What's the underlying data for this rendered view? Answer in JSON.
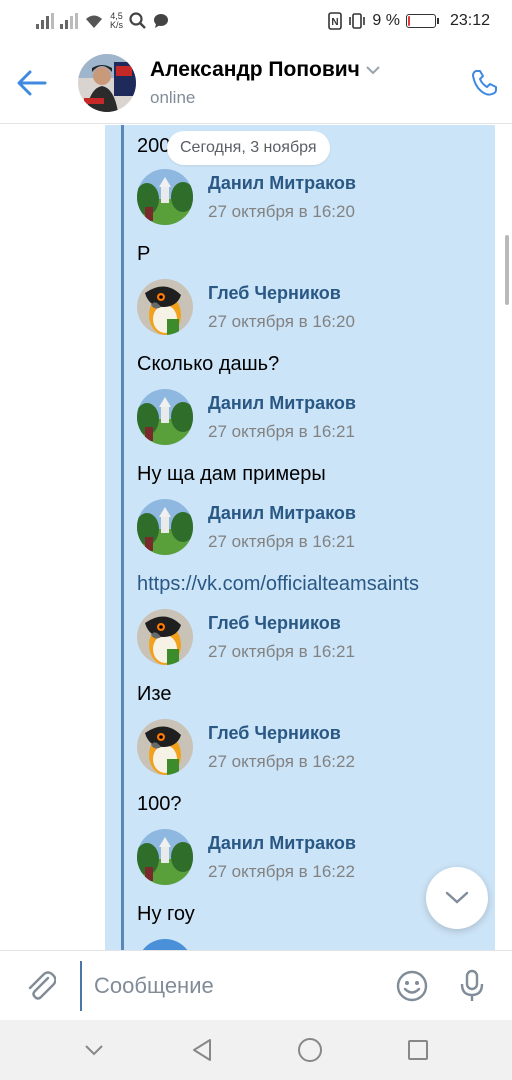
{
  "status_bar": {
    "speed_value": "4,5",
    "speed_unit": "K/s",
    "battery_percent": "9 %",
    "battery_level": 0.09,
    "time": "23:12"
  },
  "header": {
    "title": "Александр Попович",
    "status": "online"
  },
  "date_badge": "Сегодня, 3 ноября",
  "messages": [
    {
      "type": "text",
      "text": "200"
    },
    {
      "type": "sender",
      "name": "Данил Митраков",
      "time": "27 октября в 16:20",
      "avatar": "park-photo"
    },
    {
      "type": "text",
      "text": "Р"
    },
    {
      "type": "sender",
      "name": "Глеб Черников",
      "time": "27 октября в 16:20",
      "avatar": "parrot-photo"
    },
    {
      "type": "text",
      "text": "Сколько дашь?"
    },
    {
      "type": "sender",
      "name": "Данил Митраков",
      "time": "27 октября в 16:21",
      "avatar": "park-photo"
    },
    {
      "type": "text",
      "text": "Ну ща дам примеры"
    },
    {
      "type": "sender",
      "name": "Данил Митраков",
      "time": "27 октября в 16:21",
      "avatar": "park-photo"
    },
    {
      "type": "link",
      "text": "https://vk.com/officialteamsaints"
    },
    {
      "type": "sender",
      "name": "Глеб Черников",
      "time": "27 октября в 16:21",
      "avatar": "parrot-photo"
    },
    {
      "type": "text",
      "text": "Изе"
    },
    {
      "type": "sender",
      "name": "Глеб Черников",
      "time": "27 октября в 16:22",
      "avatar": "parrot-photo"
    },
    {
      "type": "text",
      "text": "100?"
    },
    {
      "type": "sender",
      "name": "Данил Митраков",
      "time": "27 октября в 16:22",
      "avatar": "park-photo"
    },
    {
      "type": "text",
      "text": "Ну гоу"
    }
  ],
  "composer": {
    "placeholder": "Сообщение"
  },
  "colors": {
    "accent": "#4a76a8",
    "link": "#2a5885",
    "forward_background": "#cce4f7"
  },
  "icons": [
    "back-arrow-icon",
    "chevron-down-icon",
    "phone-icon",
    "paperclip-icon",
    "emoji-icon",
    "microphone-icon",
    "nav-back-icon",
    "nav-home-icon",
    "nav-recents-icon"
  ]
}
